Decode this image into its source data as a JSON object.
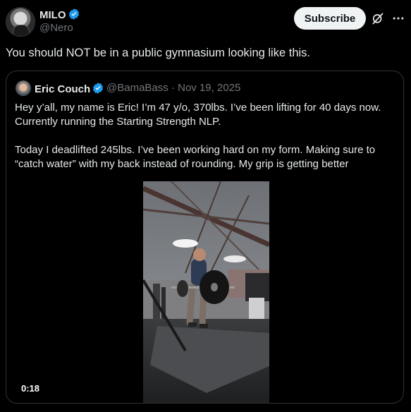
{
  "author": {
    "display_name": "MILO",
    "handle": "@Nero",
    "verified": true
  },
  "header": {
    "subscribe_label": "Subscribe",
    "icons": [
      "grok-icon",
      "more-icon"
    ]
  },
  "tweet": {
    "text": "You should NOT be in a public gymnasium looking like this."
  },
  "quoted": {
    "display_name": "Eric Couch",
    "handle": "@BamaBass",
    "separator": "·",
    "date": "Nov 19, 2025",
    "verified": true,
    "paragraph_1": "Hey y’all, my name is Eric! I’m 47 y/o, 370lbs. I’ve been lifting for 40 days now. Currently running the Starting Strength NLP.",
    "paragraph_2": "Today I deadlifted 245lbs. I’ve been working hard on my form. Making sure to “catch water” with my back instead of rounding. My grip is getting better",
    "video_duration": "0:18"
  },
  "colors": {
    "background": "#000000",
    "text": "#e7e9ea",
    "muted": "#71767b",
    "border": "#2f3336",
    "verified": "#1d9bf0"
  }
}
